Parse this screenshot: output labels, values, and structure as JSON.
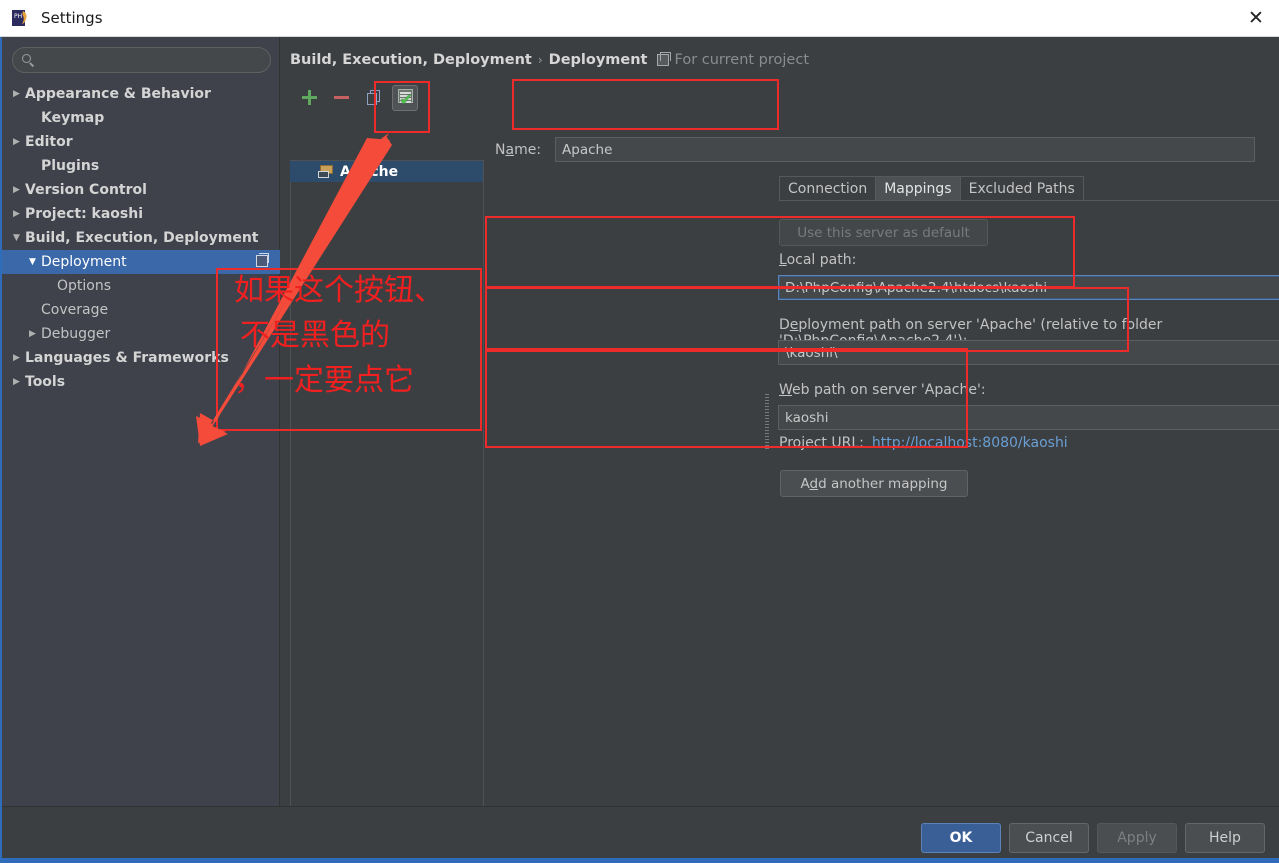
{
  "window": {
    "title": "Settings",
    "app_icon": "phpstorm-icon",
    "close_label": "✕"
  },
  "sidebar": {
    "search": {
      "value": "",
      "placeholder": "",
      "icon": "search-icon"
    },
    "items": [
      {
        "label": "Appearance & Behavior",
        "arrow": "▶",
        "indent": 0,
        "bold": true,
        "selected": false
      },
      {
        "label": "Keymap",
        "arrow": "",
        "indent": 1,
        "bold": true,
        "selected": false
      },
      {
        "label": "Editor",
        "arrow": "▶",
        "indent": 0,
        "bold": true,
        "selected": false
      },
      {
        "label": "Plugins",
        "arrow": "",
        "indent": 1,
        "bold": true,
        "selected": false
      },
      {
        "label": "Version Control",
        "arrow": "▶",
        "indent": 0,
        "bold": true,
        "selected": false
      },
      {
        "label": "Project: kaoshi",
        "arrow": "▶",
        "indent": 0,
        "bold": true,
        "selected": false
      },
      {
        "label": "Build, Execution, Deployment",
        "arrow": "▼",
        "indent": 0,
        "bold": true,
        "selected": false
      },
      {
        "label": "Deployment",
        "arrow": "▼",
        "indent": 1,
        "bold": false,
        "selected": true
      },
      {
        "label": "Options",
        "arrow": "",
        "indent": 2,
        "bold": false,
        "selected": false
      },
      {
        "label": "Coverage",
        "arrow": "",
        "indent": 1,
        "bold": false,
        "selected": false
      },
      {
        "label": "Debugger",
        "arrow": "▶",
        "indent": 1,
        "bold": false,
        "selected": false
      },
      {
        "label": "Languages & Frameworks",
        "arrow": "▶",
        "indent": 0,
        "bold": true,
        "selected": false
      },
      {
        "label": "Tools",
        "arrow": "▶",
        "indent": 0,
        "bold": true,
        "selected": false
      }
    ]
  },
  "breadcrumb": {
    "root": "Build, Execution, Deployment",
    "separator": "›",
    "leaf": "Deployment",
    "scope_icon": "project-scope-icon",
    "scope_label": "For current project"
  },
  "server_panel": {
    "toolbar": [
      {
        "name": "add-server-button",
        "icon": "plus-icon",
        "pressed": false
      },
      {
        "name": "remove-server-button",
        "icon": "minus-icon",
        "pressed": false
      },
      {
        "name": "copy-server-button",
        "icon": "copy-icon",
        "pressed": false
      },
      {
        "name": "use-as-default-button",
        "icon": "server-default-icon",
        "pressed": true
      }
    ],
    "items": [
      {
        "label": "Apache",
        "icon": "server-folder-icon",
        "selected": true
      }
    ]
  },
  "detail": {
    "name_label": "Name:",
    "name_mnemonic": "a",
    "name_value": "Apache",
    "tabs": [
      {
        "label": "Connection",
        "active": false
      },
      {
        "label": "Mappings",
        "active": true
      },
      {
        "label": "Excluded Paths",
        "active": false
      }
    ],
    "use_default_button": {
      "label": "Use this server as default",
      "enabled": false
    },
    "local_path": {
      "label": "Local path:",
      "mnemonic": "L",
      "value": "D:\\PhpConfig\\Apache2.4\\htdocs\\kaoshi",
      "browse_label": "...",
      "focused": true
    },
    "deployment_path": {
      "label": "Deployment path on server 'Apache' (relative to folder 'D:\\PhpConfig\\Apache2.4'):",
      "mnemonic": "e",
      "value": "\\kaoshi\\",
      "browse_label": "..."
    },
    "web_path": {
      "label": "Web path on server 'Apache':",
      "mnemonic": "W",
      "value": "kaoshi"
    },
    "project_url": {
      "label": "Project URL:",
      "value": "http://localhost:8080/kaoshi"
    },
    "add_mapping_button": {
      "label": "Add another mapping",
      "mnemonic": "d"
    }
  },
  "footer": {
    "buttons": [
      {
        "label": "OK",
        "style": "default"
      },
      {
        "label": "Cancel",
        "style": "normal"
      },
      {
        "label": "Apply",
        "style": "disabled"
      },
      {
        "label": "Help",
        "style": "normal"
      }
    ]
  },
  "annotations": {
    "color": "#f02020",
    "lines": [
      "如果这个按钮、",
      "不是黑色的",
      "，一定要点它"
    ]
  }
}
